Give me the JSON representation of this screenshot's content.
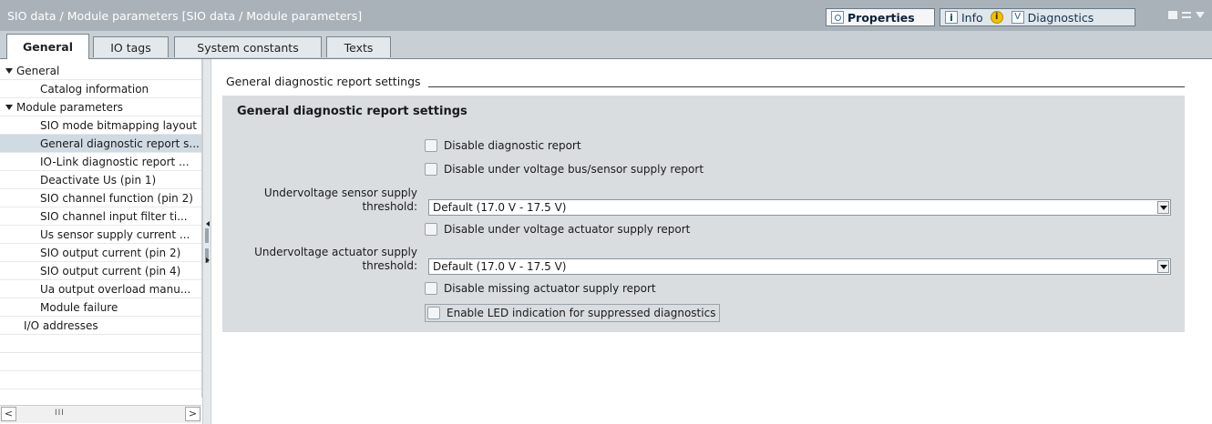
{
  "window": {
    "title": "SIO data / Module parameters [SIO data / Module parameters]",
    "panel_tabs": [
      {
        "label": "Properties",
        "icon": "properties-icon",
        "active": true
      },
      {
        "label": "Info",
        "icon": "info-icon",
        "active": false
      },
      {
        "label": "Diagnostics",
        "icon": "diagnostics-icon",
        "active": false
      }
    ]
  },
  "tabs": [
    "General",
    "IO tags",
    "System constants",
    "Texts"
  ],
  "tree": [
    {
      "label": "General",
      "expandable": true
    },
    {
      "label": "Catalog information"
    },
    {
      "label": "Module parameters",
      "expandable": true
    },
    {
      "label": "SIO mode bitmapping layout"
    },
    {
      "label": "General diagnostic report s...",
      "selected": true
    },
    {
      "label": "IO-Link diagnostic report ..."
    },
    {
      "label": "Deactivate Us (pin 1)"
    },
    {
      "label": "SIO channel function (pin 2)"
    },
    {
      "label": "SIO channel input filter ti..."
    },
    {
      "label": "Us sensor supply current ..."
    },
    {
      "label": "SIO output current (pin 2)"
    },
    {
      "label": "SIO output current (pin 4)"
    },
    {
      "label": "Ua output overload manu..."
    },
    {
      "label": "Module failure"
    },
    {
      "label": "I/O addresses"
    }
  ],
  "scrollbar": {
    "left": "<",
    "right": ">",
    "thumb": "III"
  },
  "main": {
    "section_title": "General diagnostic report settings",
    "group_title": "General diagnostic report settings",
    "checkboxes": {
      "disable_diag": "Disable diagnostic report",
      "disable_uv_bus": "Disable under voltage bus/sensor supply report",
      "disable_uv_act": "Disable under voltage actuator supply report",
      "disable_missing_act": "Disable missing actuator supply report",
      "enable_led": "Enable LED indication for suppressed diagnostics"
    },
    "uv_sensor": {
      "label_line1": "Undervoltage sensor supply",
      "label_line2": "threshold:",
      "value": "Default (17.0 V - 17.5 V)"
    },
    "uv_actuator": {
      "label_line1": "Undervoltage actuator supply",
      "label_line2": "threshold:",
      "value": "Default (17.0 V - 17.5 V)"
    }
  },
  "colors": {
    "titlebar": "#a9b2b9",
    "tabstrip": "#c8d0d6",
    "group_bg": "#d9dde0",
    "selected_row": "#cfdae3"
  }
}
